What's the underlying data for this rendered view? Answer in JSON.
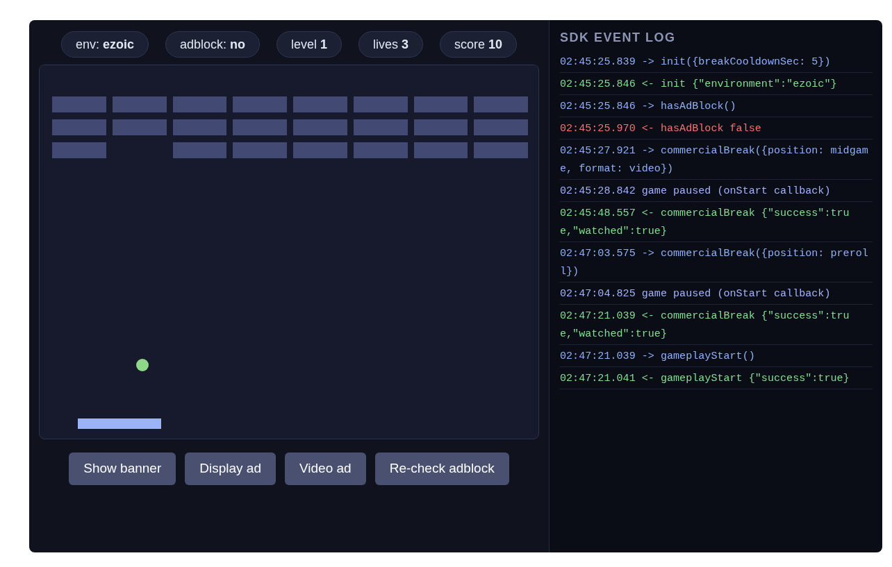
{
  "stats": [
    {
      "label": "env:",
      "value": "ezoic"
    },
    {
      "label": "adblock:",
      "value": "no"
    },
    {
      "label": "level",
      "value": "1"
    },
    {
      "label": "lives",
      "value": "3"
    },
    {
      "label": "score",
      "value": "10"
    }
  ],
  "game": {
    "bricks": [
      [
        {
          "intact": true
        },
        {
          "intact": true
        },
        {
          "intact": true
        },
        {
          "intact": true
        },
        {
          "intact": true
        },
        {
          "intact": true
        },
        {
          "intact": true
        },
        {
          "intact": true
        }
      ],
      [
        {
          "intact": true
        },
        {
          "intact": true
        },
        {
          "intact": true
        },
        {
          "intact": true
        },
        {
          "intact": true
        },
        {
          "intact": true
        },
        {
          "intact": true
        },
        {
          "intact": true
        }
      ],
      [
        {
          "intact": true
        },
        {
          "intact": false
        },
        {
          "intact": true
        },
        {
          "intact": true
        },
        {
          "intact": true
        },
        {
          "intact": true
        },
        {
          "intact": true
        },
        {
          "intact": true
        }
      ]
    ]
  },
  "buttons": [
    "Show banner",
    "Display ad",
    "Video ad",
    "Re-check adblock"
  ],
  "event_log": {
    "title": "SDK EVENT LOG",
    "entries": [
      {
        "kind": "call",
        "text": "02:45:25.839 -> init({breakCooldownSec: 5})"
      },
      {
        "kind": "result",
        "text": "02:45:25.846 <- init {\"environment\":\"ezoic\"}"
      },
      {
        "kind": "call",
        "text": "02:45:25.846 -> hasAdBlock()"
      },
      {
        "kind": "error",
        "text": "02:45:25.970 <- hasAdBlock false"
      },
      {
        "kind": "call",
        "text": "02:45:27.921 -> commercialBreak({position: midgame, format: video})"
      },
      {
        "kind": "info",
        "text": "02:45:28.842 game paused (onStart callback)"
      },
      {
        "kind": "result",
        "text": "02:45:48.557 <- commercialBreak {\"success\":true,\"watched\":true}"
      },
      {
        "kind": "call",
        "text": "02:47:03.575 -> commercialBreak({position: preroll})"
      },
      {
        "kind": "info",
        "text": "02:47:04.825 game paused (onStart callback)"
      },
      {
        "kind": "result",
        "text": "02:47:21.039 <- commercialBreak {\"success\":true,\"watched\":true}"
      },
      {
        "kind": "call",
        "text": "02:47:21.039 -> gameplayStart()"
      },
      {
        "kind": "result",
        "text": "02:47:21.041 <- gameplayStart {\"success\":true}"
      }
    ]
  }
}
